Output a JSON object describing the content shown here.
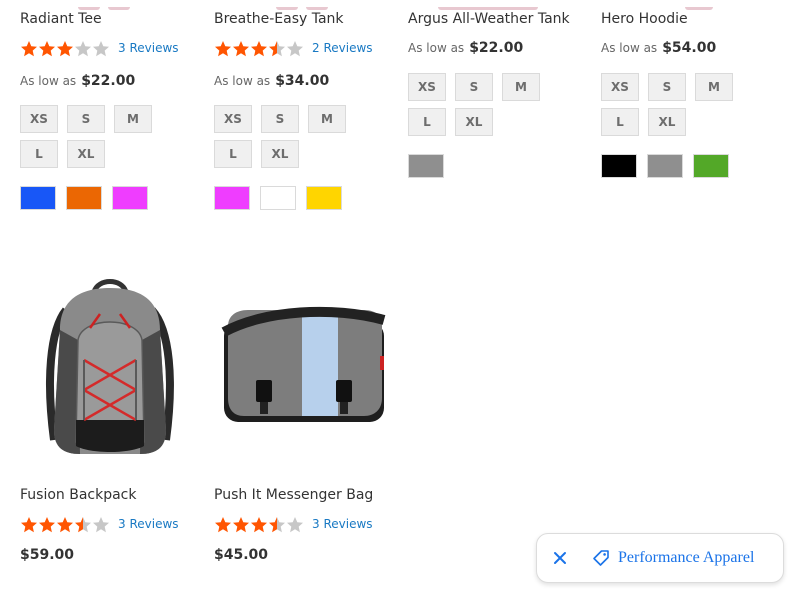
{
  "products_row1": [
    {
      "name": "Radiant Tee",
      "rating_percent": 60,
      "reviews": "3 Reviews",
      "price_label": "As low as",
      "price": "$22.00",
      "sizes": [
        "XS",
        "S",
        "M",
        "L",
        "XL"
      ],
      "swatches": [
        "#1857f7",
        "#eb6703",
        "#ef3dff"
      ]
    },
    {
      "name": "Breathe-Easy Tank",
      "rating_percent": 70,
      "reviews": "2 Reviews",
      "price_label": "As low as",
      "price": "$34.00",
      "sizes": [
        "XS",
        "S",
        "M",
        "L",
        "XL"
      ],
      "swatches": [
        "#ef3dff",
        "#ffffff",
        "#ffd500"
      ]
    },
    {
      "name": "Argus All-Weather Tank",
      "price_label": "As low as",
      "price": "$22.00",
      "sizes": [
        "XS",
        "S",
        "M",
        "L",
        "XL"
      ],
      "swatches": [
        "#8f8f8f"
      ]
    },
    {
      "name": "Hero Hoodie",
      "price_label": "As low as",
      "price": "$54.00",
      "sizes": [
        "XS",
        "S",
        "M",
        "L",
        "XL"
      ],
      "swatches": [
        "#000000",
        "#8f8f8f",
        "#53a828"
      ]
    }
  ],
  "products_row2": [
    {
      "name": "Fusion Backpack",
      "rating_percent": 70,
      "reviews": "3 Reviews",
      "price": "$59.00"
    },
    {
      "name": "Push It Messenger Bag",
      "rating_percent": 70,
      "reviews": "3 Reviews",
      "price": "$45.00"
    }
  ],
  "filter_chip": {
    "label": "Performance Apparel",
    "close_icon": "close-icon",
    "tag_icon": "tag-icon",
    "accent": "#1a73e8"
  },
  "colors": {
    "star_filled": "#ff5501",
    "star_empty": "#c7c7c7",
    "link": "#1979c3"
  }
}
